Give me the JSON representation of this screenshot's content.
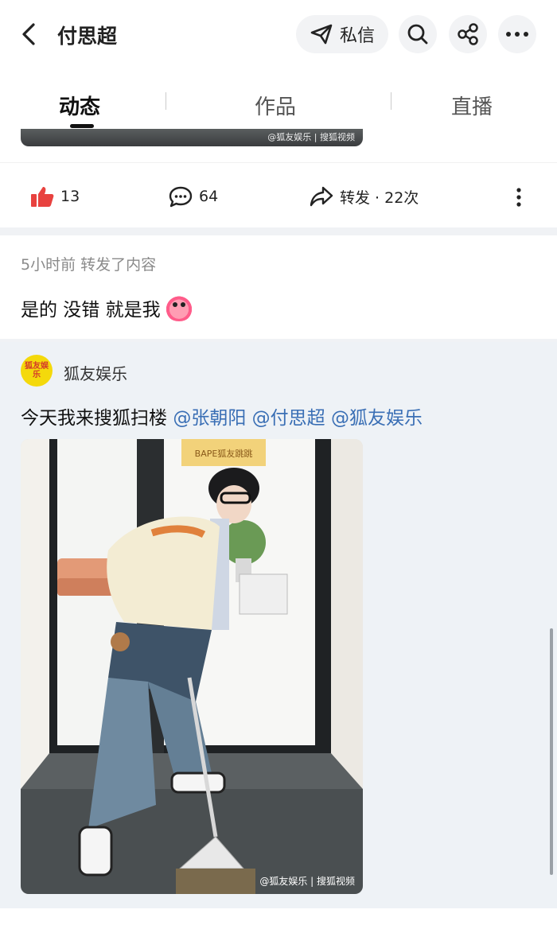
{
  "header": {
    "title": "付思超",
    "dm_label": "私信"
  },
  "tabs": [
    {
      "label": "动态",
      "active": true
    },
    {
      "label": "作品",
      "active": false
    },
    {
      "label": "直播",
      "active": false
    }
  ],
  "prev_post": {
    "watermark": "@狐友娱乐 | 搜狐视频",
    "likes": "13",
    "comments": "64",
    "reposts": "转发 · 22次"
  },
  "post": {
    "meta": "5小时前 转发了内容",
    "text": "是的 没错 就是我"
  },
  "repost": {
    "author": "狐友娱乐",
    "avatar_text": "狐友娱乐",
    "text_prefix": "今天我来搜狐扫楼 ",
    "mentions": [
      "@张朝阳",
      "@付思超",
      "@狐友娱乐"
    ],
    "watermark": "@狐友娱乐 | 搜狐视频",
    "sign_text": "BAPE狐友跳跳"
  },
  "colors": {
    "accent_like": "#e8423f",
    "mention": "#3a6fb5"
  }
}
